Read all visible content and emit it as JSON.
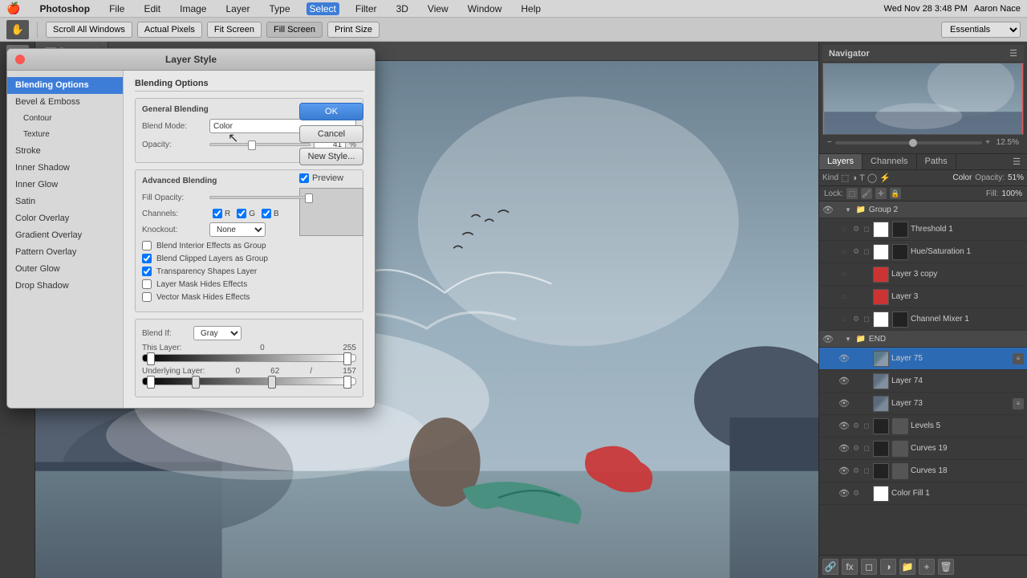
{
  "menubar": {
    "apple": "🍎",
    "app": "Photoshop",
    "items": [
      "File",
      "Edit",
      "Image",
      "Layer",
      "Type",
      "Select",
      "Filter",
      "3D",
      "View",
      "Window",
      "Help"
    ],
    "right": {
      "datetime": "Wed Nov 28  3:48 PM",
      "user": "Aaron Nace",
      "icons": [
        "search",
        "grid"
      ]
    }
  },
  "toolbar": {
    "buttons": [
      "Scroll All Windows",
      "Actual Pixels",
      "Fit Screen",
      "Fill Screen",
      "Print Size"
    ],
    "right": "Essentials"
  },
  "dialog": {
    "title": "Layer Style",
    "sidebar_items": [
      "Blending Options",
      "Bevel & Emboss",
      "Contour",
      "Texture",
      "Stroke",
      "Inner Shadow",
      "Inner Glow",
      "Satin",
      "Color Overlay",
      "Gradient Overlay",
      "Pattern Overlay",
      "Outer Glow",
      "Drop Shadow"
    ],
    "sections": {
      "main": "Blending Options",
      "general": "General Blending",
      "advanced": "Advanced Blending"
    },
    "fields": {
      "blend_mode_label": "Blend Mode:",
      "blend_mode_value": "Color",
      "opacity_label": "Opacity:",
      "opacity_value": "41",
      "opacity_pct": "%",
      "fill_opacity_label": "Fill Opacity:",
      "fill_opacity_value": "100",
      "fill_opacity_pct": "%",
      "channels_label": "Channels:",
      "channel_r": "R",
      "channel_g": "G",
      "channel_b": "B",
      "knockout_label": "Knockout:",
      "knockout_value": "None",
      "cb_blend_interior": "Blend Interior Effects as Group",
      "cb_blend_clipped": "Blend Clipped Layers as Group",
      "cb_transparency": "Transparency Shapes Layer",
      "cb_layer_mask": "Layer Mask Hides Effects",
      "cb_vector_mask": "Vector Mask Hides Effects",
      "blend_if_label": "Blend If:",
      "blend_if_value": "Gray",
      "this_layer_label": "This Layer:",
      "this_layer_min": "0",
      "this_layer_max": "255",
      "underlying_label": "Underlying Layer:",
      "underlying_min": "0",
      "underlying_mid1": "62",
      "underlying_sep": "/",
      "underlying_mid2": "157",
      "underlying_max": ""
    },
    "buttons": {
      "ok": "OK",
      "cancel": "Cancel",
      "new_style": "New Style...",
      "preview_label": "Preview"
    }
  },
  "canvas": {
    "tab": "Fill Screen",
    "zoom": "12.5%"
  },
  "navigator": {
    "title": "Navigator",
    "zoom": "12.5%"
  },
  "panels": {
    "layers": "Layers",
    "channels": "Channels",
    "paths": "Paths"
  },
  "layer_controls": {
    "kind_label": "Kind",
    "blend_label": "Color",
    "opacity_label": "Opacity:",
    "opacity_val": "51%",
    "lock_label": "Lock:",
    "fill_label": "Fill:",
    "fill_val": "100%"
  },
  "layers": [
    {
      "id": "group2",
      "type": "group",
      "visible": true,
      "name": "Group 2",
      "expanded": true,
      "indent": 0
    },
    {
      "id": "threshold1",
      "type": "adjustment",
      "visible": false,
      "name": "Threshold 1",
      "thumb": "white",
      "masked": true,
      "indent": 1
    },
    {
      "id": "hue_sat1",
      "type": "adjustment",
      "visible": false,
      "name": "Hue/Saturation 1",
      "thumb": "white",
      "masked": true,
      "indent": 1
    },
    {
      "id": "layer3copy",
      "type": "image",
      "visible": false,
      "name": "Layer 3 copy",
      "thumb": "red",
      "indent": 1
    },
    {
      "id": "layer3",
      "type": "image",
      "visible": false,
      "name": "Layer 3",
      "thumb": "red",
      "indent": 1
    },
    {
      "id": "channel_mixer1",
      "type": "adjustment",
      "visible": false,
      "name": "Channel Mixer 1",
      "thumb": "white",
      "masked": true,
      "indent": 1
    },
    {
      "id": "group_end",
      "type": "group",
      "visible": true,
      "name": "END",
      "expanded": true,
      "indent": 0
    },
    {
      "id": "layer75",
      "type": "image",
      "visible": true,
      "name": "Layer 75",
      "thumb": "image",
      "badge": true,
      "indent": 1
    },
    {
      "id": "layer74",
      "type": "image",
      "visible": true,
      "name": "Layer 74",
      "thumb": "image",
      "indent": 1
    },
    {
      "id": "layer73",
      "type": "image",
      "visible": true,
      "name": "Layer 73",
      "thumb": "image",
      "badge": true,
      "indent": 1
    },
    {
      "id": "levels5",
      "type": "adjustment",
      "visible": true,
      "name": "Levels 5",
      "thumb": "curves",
      "masked": true,
      "indent": 1
    },
    {
      "id": "curves19",
      "type": "adjustment",
      "visible": true,
      "name": "Curves 19",
      "thumb": "curves",
      "masked": true,
      "indent": 1
    },
    {
      "id": "curves18",
      "type": "adjustment",
      "visible": true,
      "name": "Curves 18",
      "thumb": "curves",
      "masked": true,
      "indent": 1
    },
    {
      "id": "colorfill1",
      "type": "adjustment",
      "visible": true,
      "name": "Color Fill 1",
      "thumb": "white",
      "masked": false,
      "indent": 1
    }
  ]
}
